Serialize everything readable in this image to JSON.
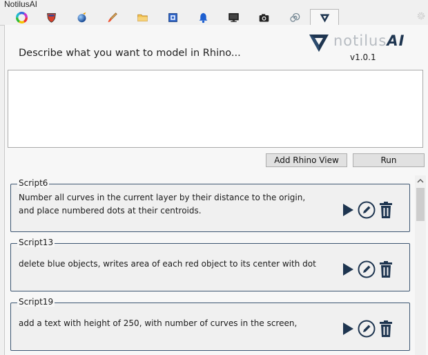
{
  "window": {
    "title": "NotilusAI"
  },
  "tabs": [
    {
      "icon": "color-wheel-icon"
    },
    {
      "icon": "shield-icon"
    },
    {
      "icon": "sphere-icon"
    },
    {
      "icon": "paintbrush-icon"
    },
    {
      "icon": "folder-icon"
    },
    {
      "icon": "document-icon"
    },
    {
      "icon": "bell-icon"
    },
    {
      "icon": "monitor-icon"
    },
    {
      "icon": "camera-icon"
    },
    {
      "icon": "spiral-icon"
    },
    {
      "icon": "notilus-logo-icon",
      "active": true
    }
  ],
  "header": {
    "prompt_label": "Describe what you want to model in Rhino...",
    "logo_light": "notilus",
    "logo_bold": "AI",
    "version": "v1.0.1"
  },
  "prompt": {
    "value": "",
    "placeholder": ""
  },
  "buttons": {
    "add_view": "Add Rhino View",
    "run": "Run"
  },
  "scripts": [
    {
      "name": "Script6",
      "text": "Number all curves in the current layer by their distance to the origin,\nand place numbered dots at their centroids."
    },
    {
      "name": "Script13",
      "text": "delete blue objects, writes area of each red object to its center with dot"
    },
    {
      "name": "Script19",
      "text": "add a text with height of 250, with number of curves in the screen,"
    }
  ],
  "colors": {
    "accent": "#1e3550",
    "border": "#3b5470",
    "logo_grey": "#b7bcc2"
  }
}
